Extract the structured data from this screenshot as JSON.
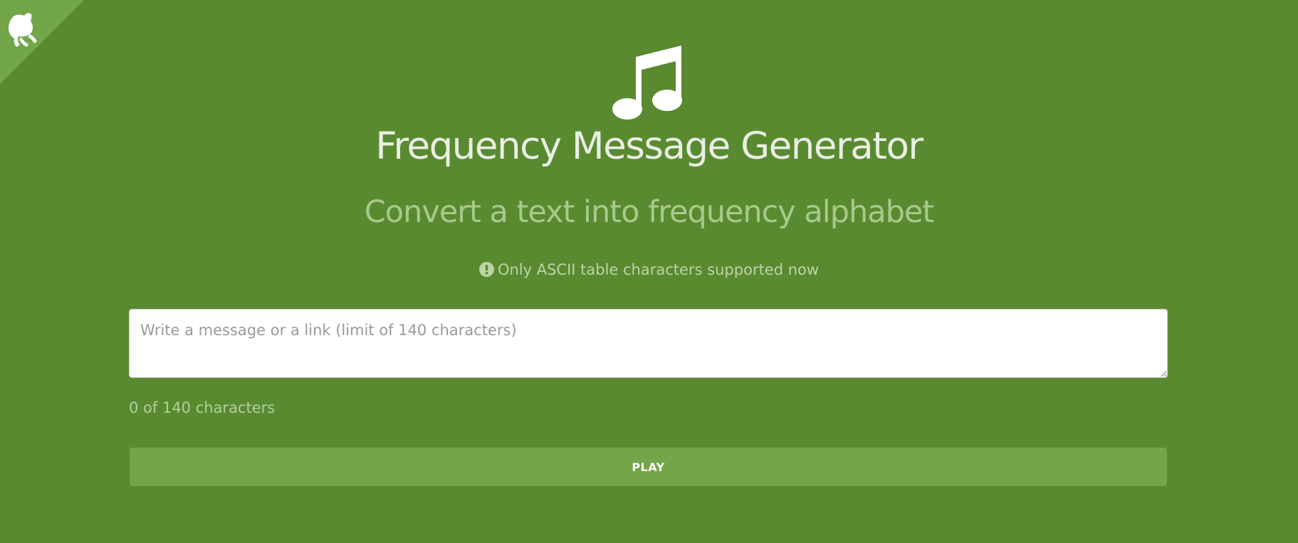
{
  "corner": {
    "icon": "github-octocat-icon",
    "color": "#72a648"
  },
  "header": {
    "icon": "music-note-icon",
    "title": "Frequency Message Generator",
    "subtitle": "Convert a text into frequency alphabet"
  },
  "notice": {
    "icon": "exclamation-circle-icon",
    "text": "Only ASCII table characters supported now"
  },
  "form": {
    "message_placeholder": "Write a message or a link (limit of 140 characters)",
    "message_value": "",
    "counter_text": "0 of 140 characters",
    "play_label": "PLAY"
  },
  "colors": {
    "background": "#5a8a30",
    "button": "#74a548",
    "title": "#e9efe4",
    "subtitle": "#a9c98c"
  }
}
